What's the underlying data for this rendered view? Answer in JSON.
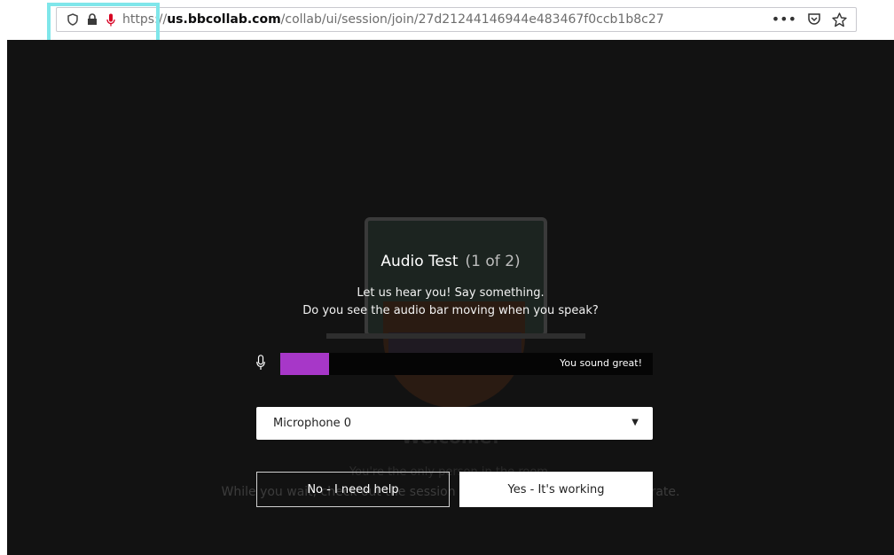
{
  "browser": {
    "url_scheme": "https",
    "url_separator": "://",
    "url_host": "us.bbcollab.com",
    "url_path": "/collab/ui/session/join/27d21244146944e483467f0ccb1b8c27",
    "more_label": "•••",
    "icons": [
      "shield-icon",
      "lock-icon",
      "microphone-icon",
      "pocket-icon",
      "star-icon"
    ]
  },
  "background": {
    "welcome": "Welcome!",
    "only_person": "You're the only person in the room.",
    "while_wait": "While you wait, check out the session menu and get ready to collaborate."
  },
  "dialog": {
    "title": "Audio Test",
    "step": "(1 of 2)",
    "instruction": "Let us hear you! Say something.",
    "question": "Do you see the audio bar moving when you speak?",
    "meter_level": 0.13,
    "meter_label": "You sound great!",
    "accent_color": "#a737c8",
    "device_selected": "Microphone 0",
    "no_button": "No - I need help",
    "yes_button": "Yes - It's working"
  }
}
